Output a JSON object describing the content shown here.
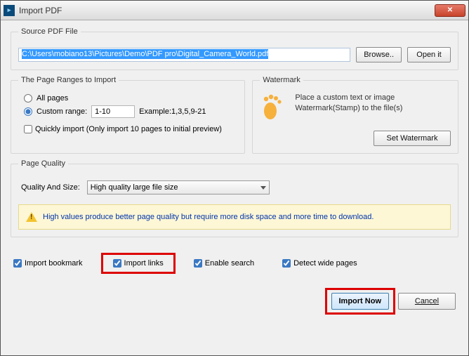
{
  "window": {
    "title": "Import PDF"
  },
  "source": {
    "legend": "Source PDF File",
    "path": "C:\\Users\\mobiano13\\Pictures\\Demo\\PDF pro\\Digital_Camera_World.pdf",
    "browse_label": "Browse..",
    "open_label": "Open it"
  },
  "ranges": {
    "legend": "The Page Ranges to Import",
    "all_label": "All pages",
    "custom_label": "Custom range:",
    "custom_value": "1-10",
    "example_label": "Example:1,3,5,9-21",
    "quick_label": "Quickly import (Only import 10 pages to  initial  preview)",
    "selected": "custom",
    "quick_checked": false
  },
  "watermark": {
    "legend": "Watermark",
    "text": "Place a custom text or image Watermark(Stamp) to the file(s)",
    "button_label": "Set Watermark"
  },
  "quality": {
    "legend": "Page Quality",
    "label": "Quality And Size:",
    "selected": "High quality large file size",
    "info": "High values produce better page quality but require more disk space and more time to download."
  },
  "checks": {
    "bookmark_label": "Import bookmark",
    "bookmark_checked": true,
    "links_label": "Import links",
    "links_checked": true,
    "search_label": "Enable search",
    "search_checked": true,
    "wide_label": "Detect wide pages",
    "wide_checked": true
  },
  "footer": {
    "import_label": "Import Now",
    "cancel_label": "Cancel"
  }
}
